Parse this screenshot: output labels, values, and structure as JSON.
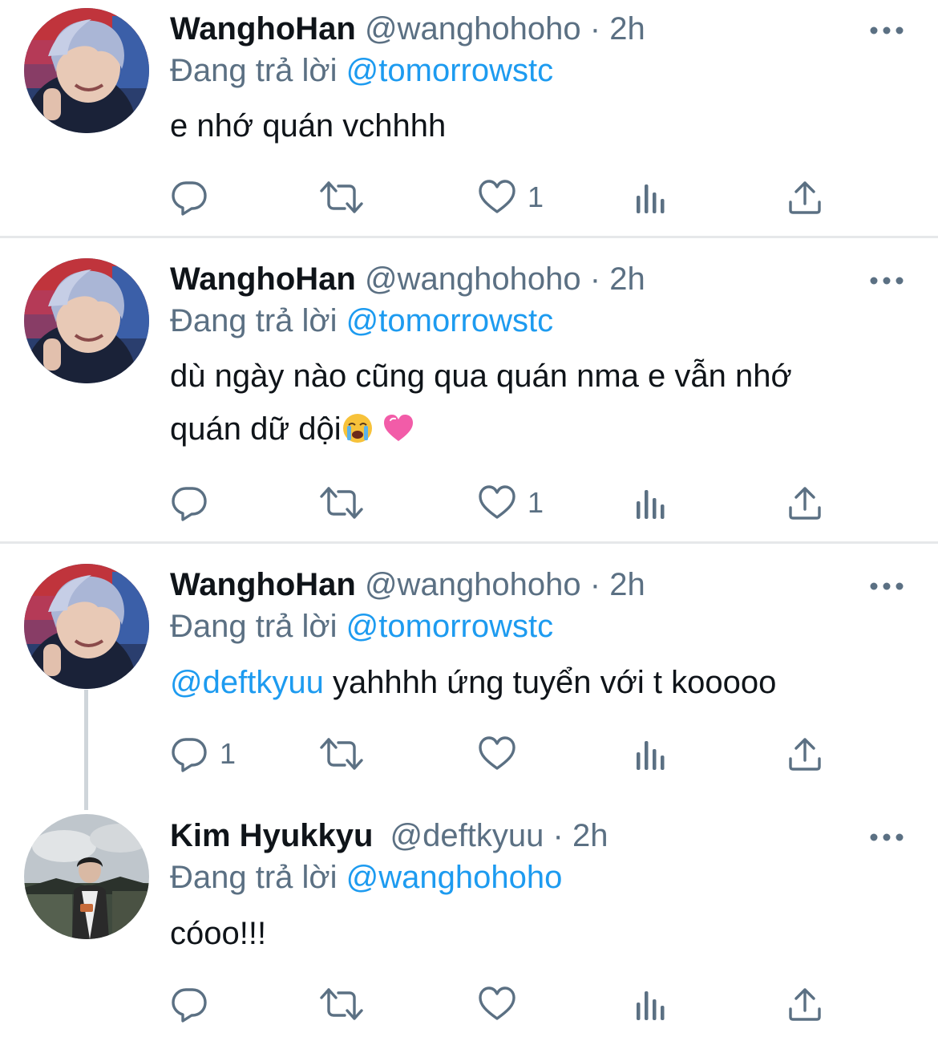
{
  "tweets": [
    {
      "name": "WanghoHan",
      "handle": "@wanghohoho",
      "separator": "·",
      "time": "2h",
      "reply_prefix": "Đang trả lời",
      "reply_to": "@tomorrowstc",
      "body": "e nhớ quán vchhhh",
      "reply_count": "",
      "like_count": "1",
      "avatar_icon": "profile-photo-silver-hair"
    },
    {
      "name": "WanghoHan",
      "handle": "@wanghohoho",
      "separator": "·",
      "time": "2h",
      "reply_prefix": "Đang trả lời",
      "reply_to": "@tomorrowstc",
      "body_line1": "dù ngày nào cũng qua quán nma e vẫn nhớ",
      "body_line2": "quán dữ dội",
      "body_emoji_1": "😭",
      "body_emoji_2": "💗",
      "reply_count": "",
      "like_count": "1",
      "avatar_icon": "profile-photo-silver-hair"
    },
    {
      "name": "WanghoHan",
      "handle": "@wanghohoho",
      "separator": "·",
      "time": "2h",
      "reply_prefix": "Đang trả lời",
      "reply_to": "@tomorrowstc",
      "body_mention": "@deftkyuu",
      "body": " yahhhh ứng tuyển với t kooooo",
      "reply_count": "1",
      "like_count": "",
      "avatar_icon": "profile-photo-silver-hair"
    },
    {
      "name": "Kim Hyukkyu",
      "handle": "@deftkyuu",
      "separator": "·",
      "time": "2h",
      "reply_prefix": "Đang trả lời",
      "reply_to": "@wanghohoho",
      "body": "cóoo!!!",
      "reply_count": "",
      "like_count": "",
      "avatar_icon": "profile-photo-outdoor"
    }
  ],
  "icons": {
    "reply": "reply-icon",
    "retweet": "retweet-icon",
    "like": "heart-icon",
    "analytics": "analytics-icon",
    "share": "share-icon",
    "more": "more-icon"
  },
  "colors": {
    "text": "#0f1419",
    "secondary": "#5b7083",
    "link": "#1d9bf0",
    "divider": "#e6e8ea",
    "thread_line": "#cfd5da"
  }
}
